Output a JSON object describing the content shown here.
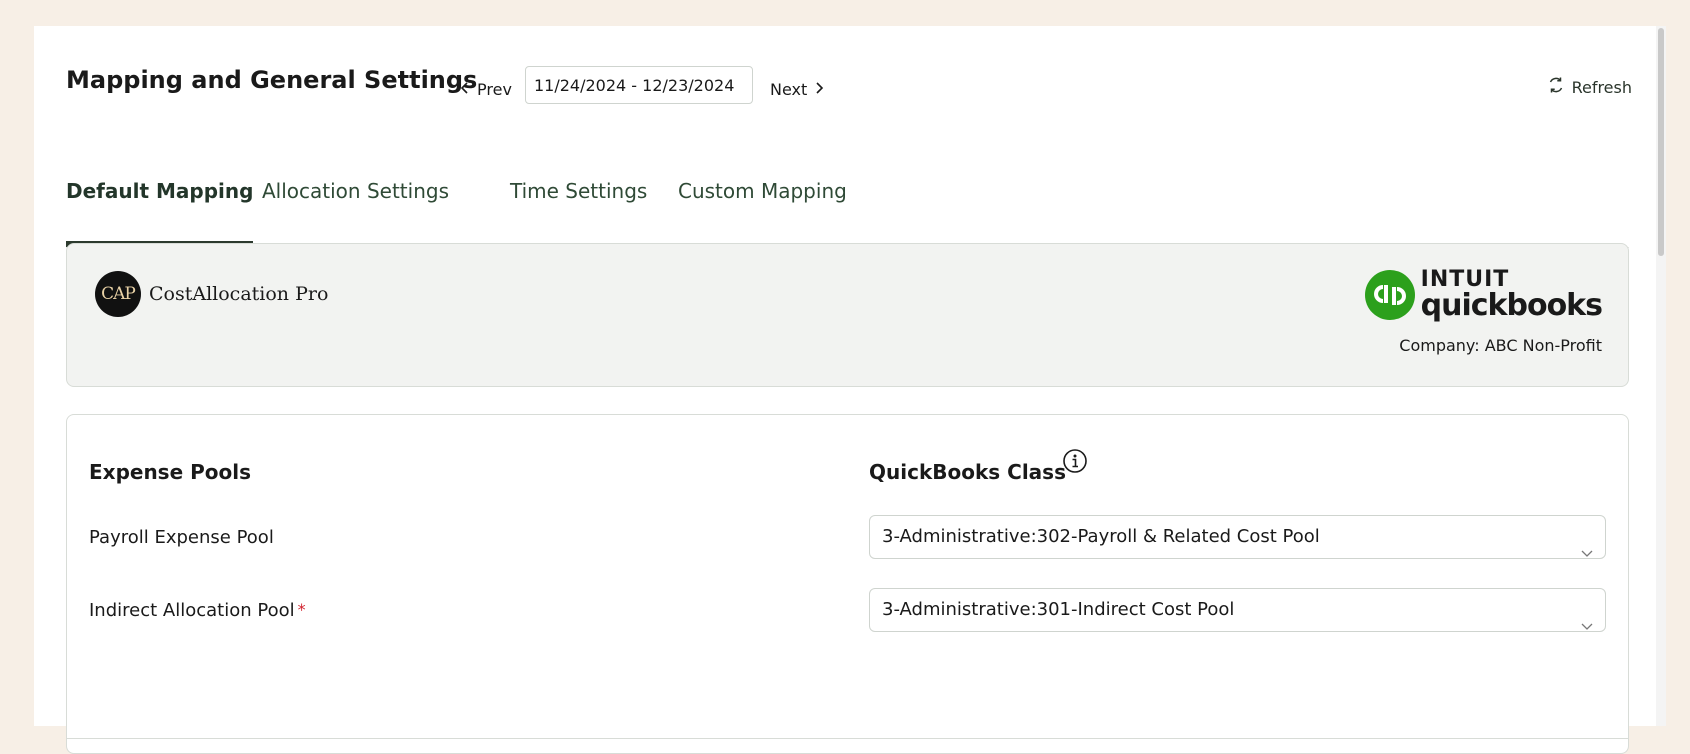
{
  "header": {
    "title": "Mapping and General Settings",
    "prev_label": "Prev",
    "date_range": "11/24/2024 - 12/23/2024",
    "next_label": "Next",
    "refresh_label": "Refresh"
  },
  "tabs": [
    {
      "label": "Default Mapping",
      "active": true
    },
    {
      "label": "Allocation Settings",
      "active": false
    },
    {
      "label": "Time Settings",
      "active": false
    },
    {
      "label": "Custom Mapping",
      "active": false
    }
  ],
  "brand": {
    "cap_initials": "CAP",
    "cap_name": "CostAllocation Pro",
    "qb_intuit": "INTUIT",
    "qb_name": "quickbooks",
    "company": "Company: ABC Non-Profit",
    "qb_color": "#2ca01c"
  },
  "mapping": {
    "left_header": "Expense Pools",
    "right_header": "QuickBooks Class",
    "rows": [
      {
        "label": "Payroll Expense Pool",
        "required": false,
        "value": "3-Administrative:302-Payroll & Related Cost Pool"
      },
      {
        "label": "Indirect Allocation Pool",
        "required": true,
        "required_mark": "*",
        "value": "3-Administrative:301-Indirect Cost Pool"
      }
    ]
  },
  "icons": {
    "prev": "chevron-left-icon",
    "next": "chevron-right-icon",
    "refresh": "refresh-icon",
    "info": "info-icon",
    "dropdown": "chevron-down-icon"
  },
  "colors": {
    "background": "#f7efe6",
    "active_tab_underline": "#2c3a2e",
    "required": "#d1242f"
  }
}
